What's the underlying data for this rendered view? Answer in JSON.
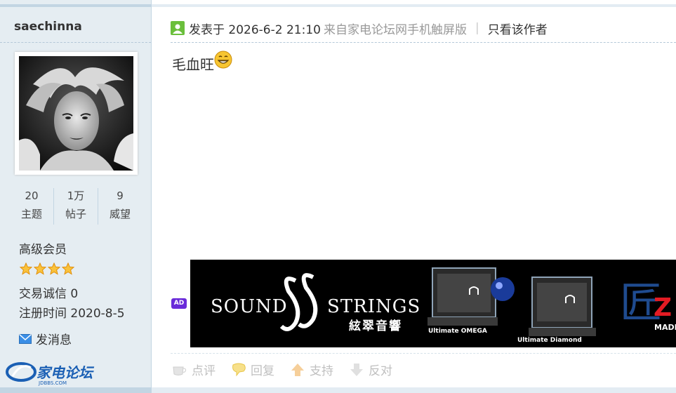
{
  "author": {
    "username": "saechinna",
    "stats": [
      {
        "value": "20",
        "label": "主题"
      },
      {
        "value": "1万",
        "label": "帖子"
      },
      {
        "value": "9",
        "label": "威望"
      }
    ],
    "group": "高级会员",
    "stars": 4,
    "trade_credit": "交易诚信 0",
    "register": "注册时间 2020-8-5",
    "message_label": "发消息",
    "logo_text": "家电论坛",
    "logo_sub": "JDBBS.COM"
  },
  "post": {
    "posted_label": "发表于 2026-6-2 21:10",
    "source": "来自家电论坛网手机触屏版",
    "separator": "|",
    "only_author": "只看该作者",
    "content": "毛血旺"
  },
  "ad": {
    "badge": "AD",
    "brand_left": "SOUND",
    "brand_right": "STRINGS",
    "brand_cn": "絃翠音響",
    "product1": "Ultimate OMEGA",
    "product2": "Ultimate Diamond",
    "tagline": "MADE"
  },
  "actions": [
    {
      "label": "点评",
      "icon": "coffee-icon"
    },
    {
      "label": "回复",
      "icon": "reply-bubble-icon"
    },
    {
      "label": "支持",
      "icon": "thumb-up-arrow-icon"
    },
    {
      "label": "反对",
      "icon": "thumb-down-arrow-icon"
    }
  ],
  "colors": {
    "sidebar_bg": "#e5edf2",
    "border": "#c2d5e3",
    "ad_badge": "#6a2bd9",
    "star": "#f5a623"
  }
}
